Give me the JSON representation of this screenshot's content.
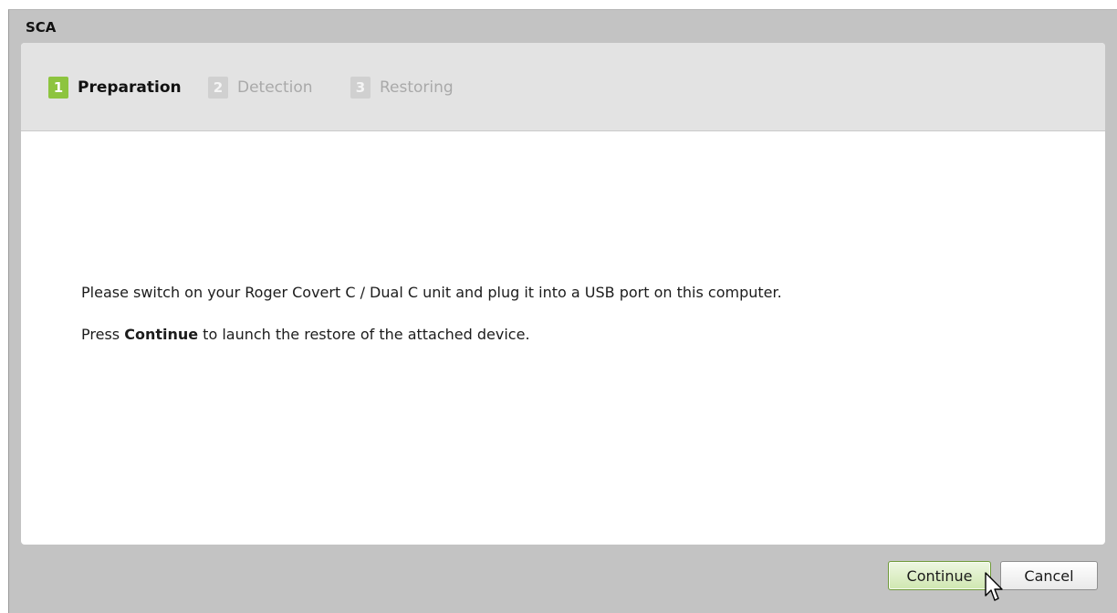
{
  "window": {
    "title": "SCA"
  },
  "steps": [
    {
      "number": "1",
      "label": "Preparation",
      "state": "active"
    },
    {
      "number": "2",
      "label": "Detection",
      "state": "inactive"
    },
    {
      "number": "3",
      "label": "Restoring",
      "state": "inactive"
    }
  ],
  "content": {
    "line1": "Please switch on your Roger Covert C / Dual C unit and plug it into a USB port on this computer.",
    "line2_prefix": "Press ",
    "line2_bold": "Continue",
    "line2_suffix": " to launch the restore of the attached device."
  },
  "buttons": {
    "continue_label": "Continue",
    "cancel_label": "Cancel"
  },
  "colors": {
    "active_step": "#8dc43f",
    "inactive_step": "#d0d0d0",
    "window_bg": "#c3c3c3",
    "continue_border": "#6f9a3a"
  },
  "icons": {
    "cursor": "mouse-pointer-icon"
  }
}
